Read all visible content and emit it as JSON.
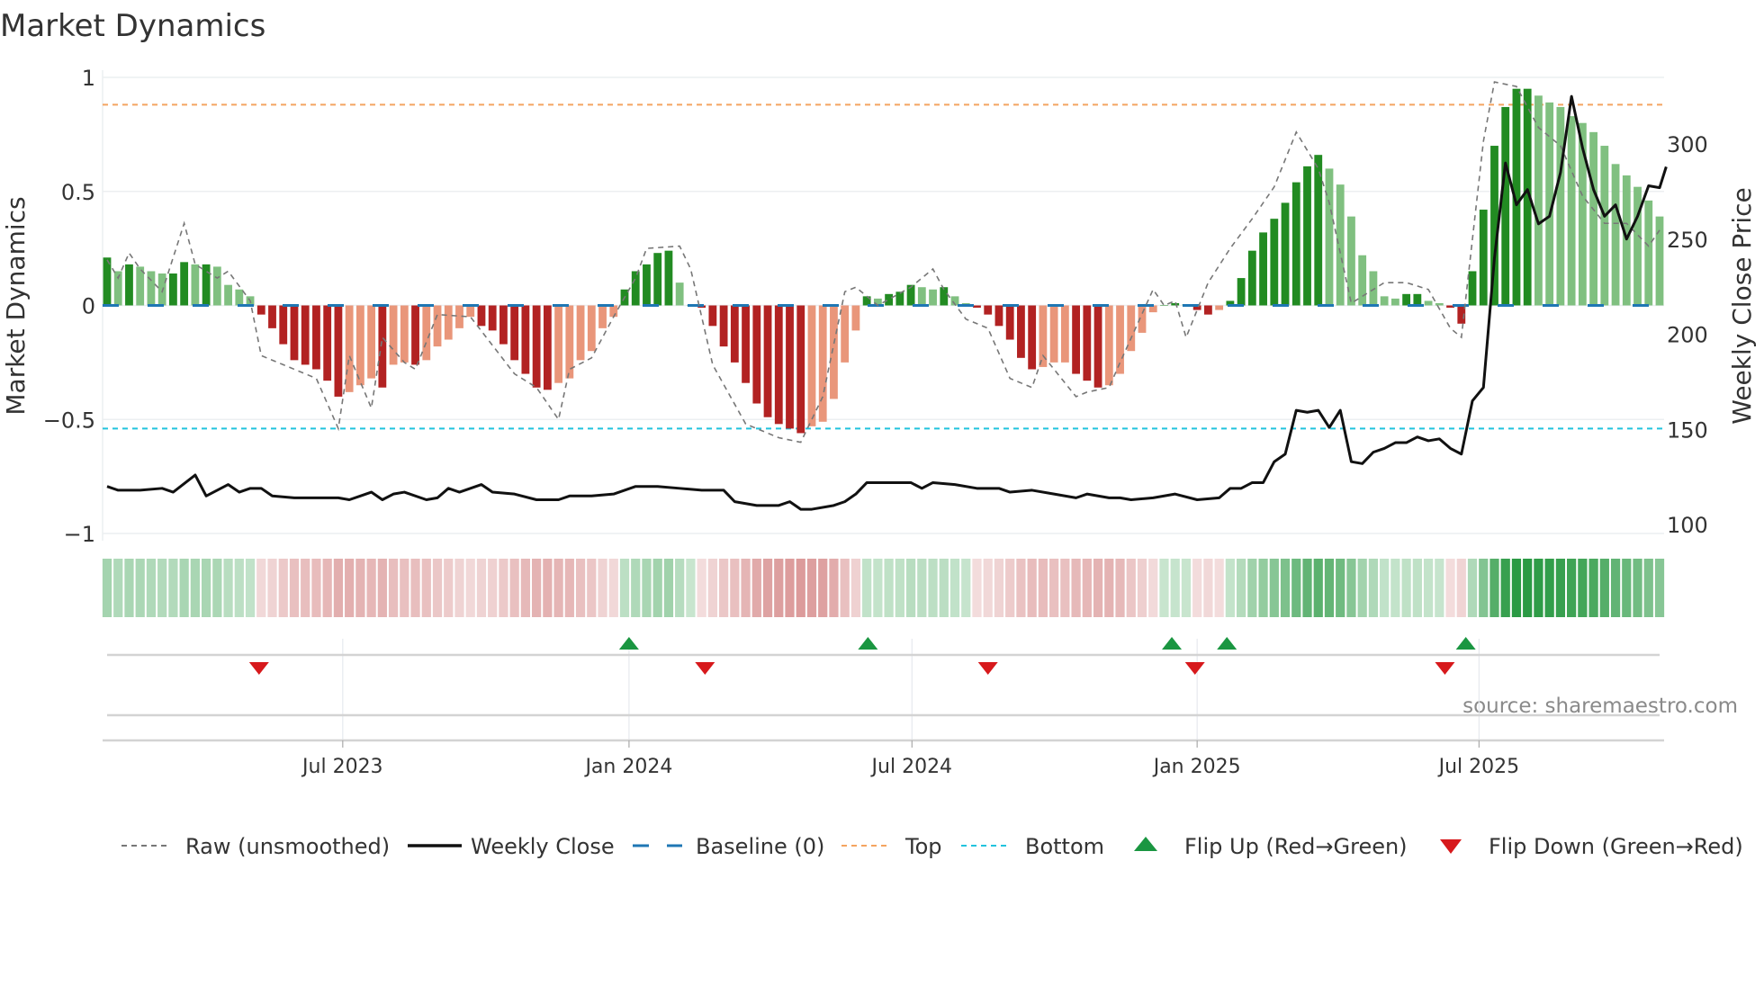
{
  "chart_data": {
    "type": "bar",
    "title": "Market Dynamics",
    "ylabel": "Market Dynamics",
    "y2label": "Weekly Close Price",
    "ylim": [
      -1,
      1
    ],
    "y2lim": [
      100,
      300
    ],
    "yticks": [
      {
        "v": 1,
        "label": "1"
      },
      {
        "v": 0.5,
        "label": "0.5"
      },
      {
        "v": 0,
        "label": "0"
      },
      {
        "v": -0.5,
        "label": "−0.5"
      },
      {
        "v": -1,
        "label": "−1"
      }
    ],
    "y2ticks": [
      {
        "v": 300,
        "label": "300"
      },
      {
        "v": 250,
        "label": "250"
      },
      {
        "v": 200,
        "label": "200"
      },
      {
        "v": 150,
        "label": "150"
      },
      {
        "v": 100,
        "label": "100"
      }
    ],
    "xticks": [
      {
        "week": 21.4,
        "label": "Jul 2023"
      },
      {
        "week": 47.4,
        "label": "Jan 2024"
      },
      {
        "week": 73.1,
        "label": "Jul 2024"
      },
      {
        "week": 99,
        "label": "Jan 2025"
      },
      {
        "week": 124.6,
        "label": "Jul 2025"
      }
    ],
    "top_level": 0.88,
    "bottom_level": -0.54,
    "baseline": 0,
    "grid": true,
    "bars": [
      0.21,
      0.15,
      0.18,
      0.17,
      0.15,
      0.14,
      0.14,
      0.19,
      0.18,
      0.18,
      0.17,
      0.09,
      0.07,
      0.04,
      -0.04,
      -0.1,
      -0.17,
      -0.24,
      -0.26,
      -0.28,
      -0.33,
      -0.4,
      -0.38,
      -0.35,
      -0.32,
      -0.36,
      -0.26,
      -0.25,
      -0.26,
      -0.24,
      -0.18,
      -0.15,
      -0.1,
      -0.05,
      -0.09,
      -0.11,
      -0.17,
      -0.24,
      -0.3,
      -0.36,
      -0.37,
      -0.34,
      -0.32,
      -0.24,
      -0.2,
      -0.1,
      -0.05,
      0.07,
      0.15,
      0.18,
      0.23,
      0.24,
      0.1,
      0.0,
      -0.01,
      -0.09,
      -0.18,
      -0.25,
      -0.34,
      -0.43,
      -0.49,
      -0.52,
      -0.54,
      -0.56,
      -0.53,
      -0.51,
      -0.41,
      -0.25,
      -0.11,
      0.04,
      0.03,
      0.05,
      0.06,
      0.09,
      0.08,
      0.07,
      0.08,
      0.04,
      0.01,
      -0.01,
      -0.04,
      -0.09,
      -0.15,
      -0.23,
      -0.28,
      -0.27,
      -0.25,
      -0.25,
      -0.3,
      -0.33,
      -0.36,
      -0.35,
      -0.3,
      -0.2,
      -0.12,
      -0.03,
      0.0,
      0.01,
      0.005,
      -0.02,
      -0.04,
      -0.02,
      0.02,
      0.12,
      0.24,
      0.32,
      0.38,
      0.45,
      0.54,
      0.61,
      0.66,
      0.6,
      0.53,
      0.39,
      0.22,
      0.15,
      0.04,
      0.03,
      0.05,
      0.05,
      0.02,
      0.01,
      -0.01,
      -0.08,
      0.15,
      0.42,
      0.7,
      0.87,
      0.95,
      0.95,
      0.92,
      0.89,
      0.87,
      0.83,
      0.8,
      0.76,
      0.7,
      0.62,
      0.57,
      0.52,
      0.46,
      0.39
    ],
    "raw": [
      [
        0,
        0.2
      ],
      [
        1,
        0.12
      ],
      [
        2,
        0.23
      ],
      [
        3,
        0.16
      ],
      [
        5,
        0.06
      ],
      [
        7,
        0.36
      ],
      [
        8,
        0.18
      ],
      [
        10,
        0.12
      ],
      [
        11,
        0.15
      ],
      [
        13,
        0.02
      ],
      [
        14,
        -0.22
      ],
      [
        16,
        -0.26
      ],
      [
        19,
        -0.32
      ],
      [
        21,
        -0.54
      ],
      [
        22,
        -0.22
      ],
      [
        24,
        -0.45
      ],
      [
        25,
        -0.14
      ],
      [
        27,
        -0.25
      ],
      [
        28,
        -0.28
      ],
      [
        30,
        -0.04
      ],
      [
        33,
        -0.05
      ],
      [
        37,
        -0.3
      ],
      [
        39,
        -0.36
      ],
      [
        41,
        -0.5
      ],
      [
        42,
        -0.28
      ],
      [
        44,
        -0.23
      ],
      [
        46,
        -0.05
      ],
      [
        48,
        0.12
      ],
      [
        49,
        0.25
      ],
      [
        52,
        0.26
      ],
      [
        53,
        0.16
      ],
      [
        55,
        -0.26
      ],
      [
        58,
        -0.52
      ],
      [
        60,
        -0.56
      ],
      [
        61,
        -0.58
      ],
      [
        63,
        -0.6
      ],
      [
        65,
        -0.4
      ],
      [
        67,
        0.06
      ],
      [
        68,
        0.08
      ],
      [
        70,
        0.0
      ],
      [
        73,
        0.08
      ],
      [
        75,
        0.16
      ],
      [
        76,
        0.07
      ],
      [
        78,
        -0.06
      ],
      [
        80,
        -0.1
      ],
      [
        82,
        -0.32
      ],
      [
        84,
        -0.36
      ],
      [
        85,
        -0.22
      ],
      [
        88,
        -0.4
      ],
      [
        89,
        -0.38
      ],
      [
        91,
        -0.36
      ],
      [
        92,
        -0.25
      ],
      [
        95,
        0.07
      ],
      [
        96,
        0.0
      ],
      [
        97,
        0.02
      ],
      [
        98,
        -0.14
      ],
      [
        100,
        0.1
      ],
      [
        102,
        0.25
      ],
      [
        104,
        0.38
      ],
      [
        106,
        0.52
      ],
      [
        108,
        0.76
      ],
      [
        110,
        0.6
      ],
      [
        111,
        0.45
      ],
      [
        113,
        0.01
      ],
      [
        116,
        0.1
      ],
      [
        118,
        0.1
      ],
      [
        120,
        0.07
      ],
      [
        122,
        -0.1
      ],
      [
        123,
        -0.14
      ],
      [
        125,
        0.72
      ],
      [
        126,
        0.98
      ],
      [
        128,
        0.96
      ],
      [
        130,
        0.78
      ],
      [
        132,
        0.7
      ],
      [
        134,
        0.48
      ],
      [
        136,
        0.36
      ],
      [
        138,
        0.36
      ],
      [
        140,
        0.26
      ],
      [
        141,
        0.33
      ]
    ],
    "close": [
      [
        0,
        120
      ],
      [
        1,
        118
      ],
      [
        3,
        118
      ],
      [
        5,
        119
      ],
      [
        6,
        117
      ],
      [
        8,
        126
      ],
      [
        9,
        115
      ],
      [
        11,
        121
      ],
      [
        12,
        117
      ],
      [
        13,
        119
      ],
      [
        14,
        119
      ],
      [
        15,
        115
      ],
      [
        17,
        114
      ],
      [
        21,
        114
      ],
      [
        22,
        113
      ],
      [
        23,
        115
      ],
      [
        24,
        117
      ],
      [
        25,
        113
      ],
      [
        26,
        116
      ],
      [
        27,
        117
      ],
      [
        29,
        113
      ],
      [
        30,
        114
      ],
      [
        31,
        119
      ],
      [
        32,
        117
      ],
      [
        34,
        121
      ],
      [
        35,
        117
      ],
      [
        37,
        116
      ],
      [
        39,
        113
      ],
      [
        41,
        113
      ],
      [
        42,
        115
      ],
      [
        44,
        115
      ],
      [
        46,
        116
      ],
      [
        47,
        118
      ],
      [
        48,
        120
      ],
      [
        50,
        120
      ],
      [
        52,
        119
      ],
      [
        54,
        118
      ],
      [
        56,
        118
      ],
      [
        57,
        112
      ],
      [
        59,
        110
      ],
      [
        61,
        110
      ],
      [
        62,
        112
      ],
      [
        63,
        108
      ],
      [
        64,
        108
      ],
      [
        66,
        110
      ],
      [
        67,
        112
      ],
      [
        68,
        116
      ],
      [
        69,
        122
      ],
      [
        71,
        122
      ],
      [
        73,
        122
      ],
      [
        74,
        119
      ],
      [
        75,
        122
      ],
      [
        77,
        121
      ],
      [
        79,
        119
      ],
      [
        81,
        119
      ],
      [
        82,
        117
      ],
      [
        84,
        118
      ],
      [
        86,
        116
      ],
      [
        88,
        114
      ],
      [
        89,
        116
      ],
      [
        91,
        114
      ],
      [
        92,
        114
      ],
      [
        93,
        113
      ],
      [
        95,
        114
      ],
      [
        97,
        116
      ],
      [
        99,
        113
      ],
      [
        101,
        114
      ],
      [
        102,
        119
      ],
      [
        103,
        119
      ],
      [
        104,
        122
      ],
      [
        105,
        122
      ],
      [
        106,
        133
      ],
      [
        107,
        137
      ],
      [
        108,
        160
      ],
      [
        109,
        159
      ],
      [
        110,
        160
      ],
      [
        111,
        151
      ],
      [
        112,
        160
      ],
      [
        113,
        133
      ],
      [
        114,
        132
      ],
      [
        115,
        138
      ],
      [
        116,
        140
      ],
      [
        117,
        143
      ],
      [
        118,
        143
      ],
      [
        119,
        146
      ],
      [
        120,
        144
      ],
      [
        121,
        145
      ],
      [
        122,
        140
      ],
      [
        123,
        137
      ],
      [
        124,
        165
      ],
      [
        125,
        172
      ],
      [
        126,
        240
      ],
      [
        127,
        290
      ],
      [
        128,
        268
      ],
      [
        129,
        276
      ],
      [
        130,
        258
      ],
      [
        131,
        262
      ],
      [
        132,
        285
      ],
      [
        133,
        325
      ],
      [
        134,
        298
      ],
      [
        135,
        276
      ],
      [
        136,
        262
      ],
      [
        137,
        268
      ],
      [
        138,
        250
      ],
      [
        139,
        262
      ],
      [
        140,
        278
      ],
      [
        141,
        277
      ],
      [
        141.6,
        288
      ]
    ],
    "flip_up_weeks": [
      47.4,
      69.1,
      96.7,
      101.7,
      123.4
    ],
    "flip_down_weeks": [
      13.8,
      54.3,
      80.0,
      98.8,
      121.5
    ],
    "colors": {
      "pos_up": "#228b22",
      "pos_down": "#80c080",
      "neg_down": "#b22222",
      "neg_up": "#e9967a",
      "top": "#f4a460",
      "bottom": "#22c3dd",
      "baseline": "#1f77b4",
      "close": "#111111",
      "raw": "#777777",
      "flip_up": "#1a9641",
      "flip_down": "#d7191c"
    },
    "legend": [
      {
        "key": "raw",
        "label": "Raw (unsmoothed)"
      },
      {
        "key": "close",
        "label": "Weekly Close"
      },
      {
        "key": "baseline",
        "label": "Baseline (0)"
      },
      {
        "key": "top",
        "label": "Top"
      },
      {
        "key": "bottom",
        "label": "Bottom"
      },
      {
        "key": "flip_up",
        "label": "Flip Up (Red→Green)"
      },
      {
        "key": "flip_down",
        "label": "Flip Down (Green→Red)"
      }
    ],
    "source": "source: sharemaestro.com"
  }
}
